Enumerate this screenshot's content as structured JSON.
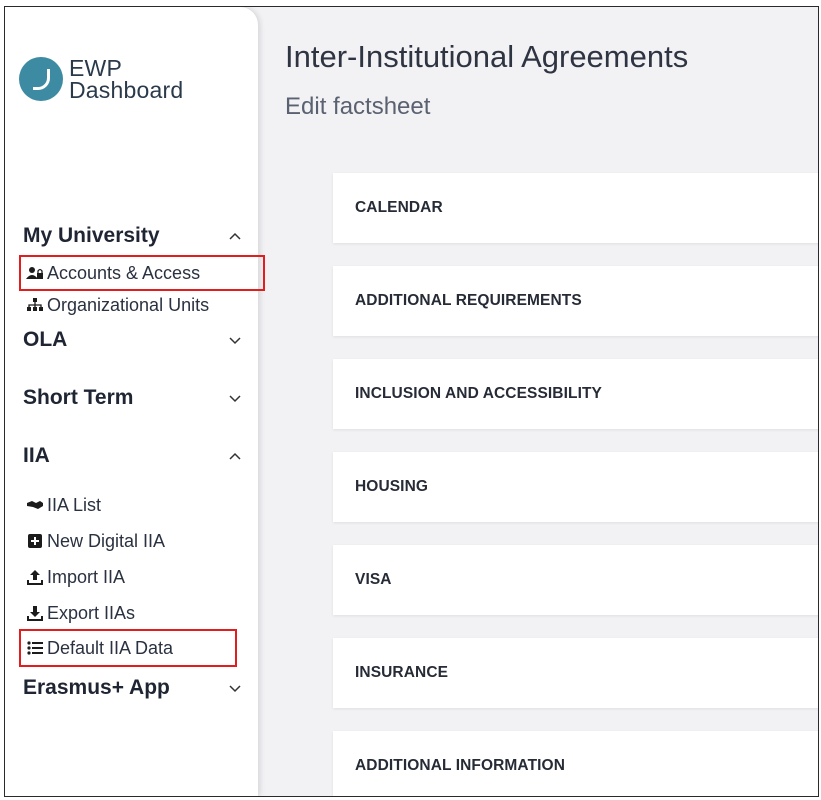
{
  "logo": {
    "line1": "EWP",
    "line2": "Dashboard"
  },
  "header": {
    "title": "Inter-Institutional Agreements",
    "subtitle": "Edit factsheet"
  },
  "sidebar": {
    "my_university": {
      "label": "My University",
      "items": [
        {
          "label": "Accounts & Access",
          "icon": "user-lock-icon"
        },
        {
          "label": "Organizational Units",
          "icon": "sitemap-icon"
        }
      ]
    },
    "ola": {
      "label": "OLA"
    },
    "short_term": {
      "label": "Short Term"
    },
    "iia": {
      "label": "IIA",
      "items": [
        {
          "label": "IIA List",
          "icon": "handshake-icon"
        },
        {
          "label": "New Digital IIA",
          "icon": "plus-square-icon"
        },
        {
          "label": "Import IIA",
          "icon": "upload-icon"
        },
        {
          "label": "Export IIAs",
          "icon": "download-icon"
        },
        {
          "label": "Default IIA Data",
          "icon": "list-icon"
        }
      ]
    },
    "erasmus_app": {
      "label": "Erasmus+ App"
    }
  },
  "sections": [
    "CALENDAR",
    "ADDITIONAL REQUIREMENTS",
    "INCLUSION AND ACCESSIBILITY",
    "HOUSING",
    "VISA",
    "INSURANCE",
    "ADDITIONAL INFORMATION"
  ],
  "colors": {
    "highlight": "#e11d1d",
    "logo": "#3d8aa3",
    "background": "#f2f2f5"
  }
}
